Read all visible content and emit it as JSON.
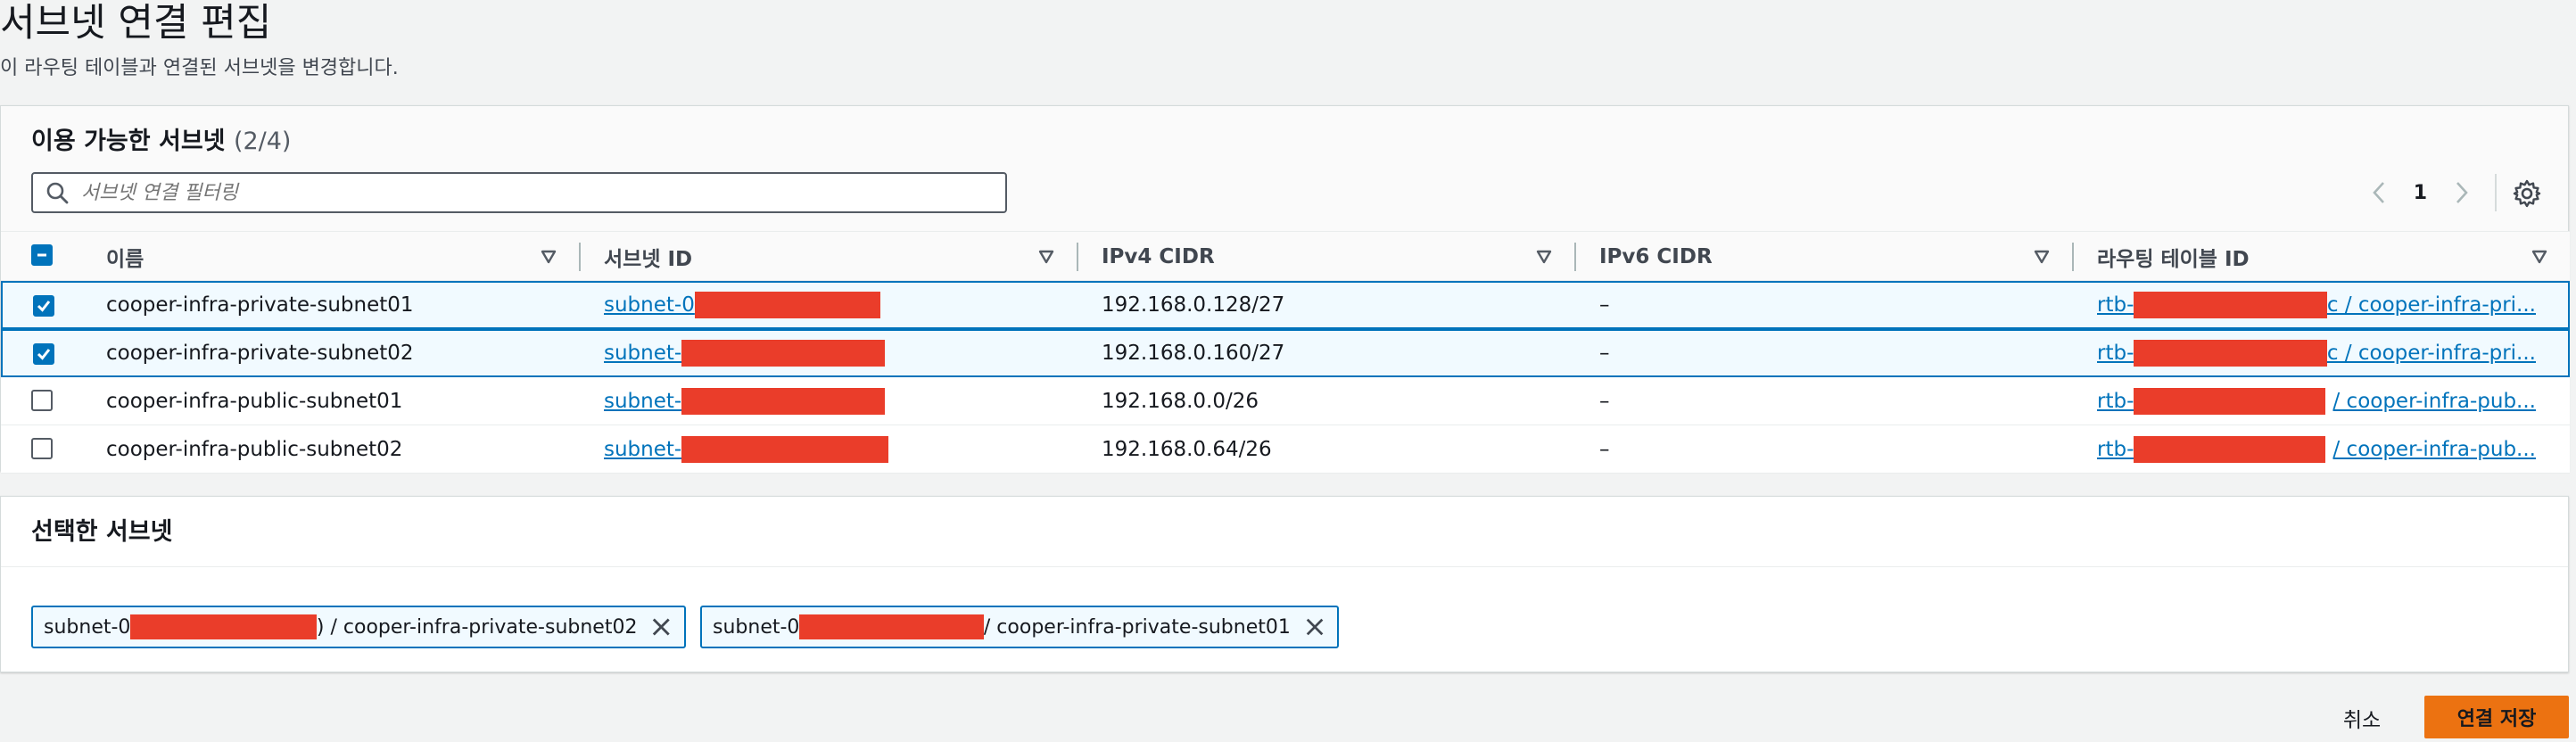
{
  "page": {
    "title": "서브넷 연결 편집",
    "description": "이 라우팅 테이블과 연결된 서브넷을 변경합니다."
  },
  "available": {
    "title": "이용 가능한 서브넷",
    "count": "(2/4)",
    "filter_placeholder": "서브넷 연결 필터링",
    "current_page": "1",
    "columns": [
      "이름",
      "서브넷 ID",
      "IPv4 CIDR",
      "IPv6 CIDR",
      "라우팅 테이블 ID"
    ],
    "rows": [
      {
        "name": "cooper-infra-private-subnet01",
        "subnet_prefix": "subnet-0",
        "ipv4": "192.168.0.128/27",
        "ipv6": "–",
        "rt_prefix": "rtb-",
        "rt_suffix": "c / cooper-infra-pri...",
        "checked": true
      },
      {
        "name": "cooper-infra-private-subnet02",
        "subnet_prefix": "subnet-",
        "ipv4": "192.168.0.160/27",
        "ipv6": "–",
        "rt_prefix": "rtb-",
        "rt_suffix": "c / cooper-infra-pri...",
        "checked": true
      },
      {
        "name": "cooper-infra-public-subnet01",
        "subnet_prefix": "subnet-",
        "ipv4": "192.168.0.0/26",
        "ipv6": "–",
        "rt_prefix": "rtb-",
        "rt_suffix": "/ cooper-infra-pub...",
        "checked": false
      },
      {
        "name": "cooper-infra-public-subnet02",
        "subnet_prefix": "subnet-",
        "ipv4": "192.168.0.64/26",
        "ipv6": "–",
        "rt_prefix": "rtb-",
        "rt_suffix": "/ cooper-infra-pub...",
        "checked": false
      }
    ]
  },
  "selected": {
    "title": "선택한 서브넷",
    "tokens": [
      {
        "prefix": "subnet-0",
        "suffix": ") / cooper-infra-private-subnet02"
      },
      {
        "prefix": "subnet-0",
        "suffix": "/ cooper-infra-private-subnet01"
      }
    ]
  },
  "footer": {
    "cancel_label": "취소",
    "save_label": "연결 저장"
  },
  "colors": {
    "accent": "#0073bb",
    "primary_button": "#ec7211",
    "redaction": "#ea3d2a"
  }
}
